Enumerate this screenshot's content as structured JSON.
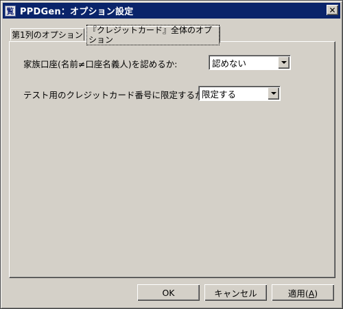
{
  "window": {
    "title": "PPDGen：オプション設定",
    "close_glyph": "✕",
    "app_icon_glyph": "覧"
  },
  "tabs": [
    {
      "label": "第1列のオプション",
      "active": false
    },
    {
      "label": "『クレジットカード』全体のオプション",
      "active": true
    }
  ],
  "options": [
    {
      "label": "家族口座(名前≠口座名義人)を認めるか:",
      "value": "認めない"
    },
    {
      "label": "テスト用のクレジットカード番号に限定するか:",
      "value": "限定する"
    }
  ],
  "buttons": {
    "ok": "OK",
    "cancel": "キャンセル",
    "apply_prefix": "適用(",
    "apply_mnemonic": "A",
    "apply_suffix": ")"
  },
  "colors": {
    "titlebar": "#0a246a",
    "face": "#d4d0c8"
  }
}
